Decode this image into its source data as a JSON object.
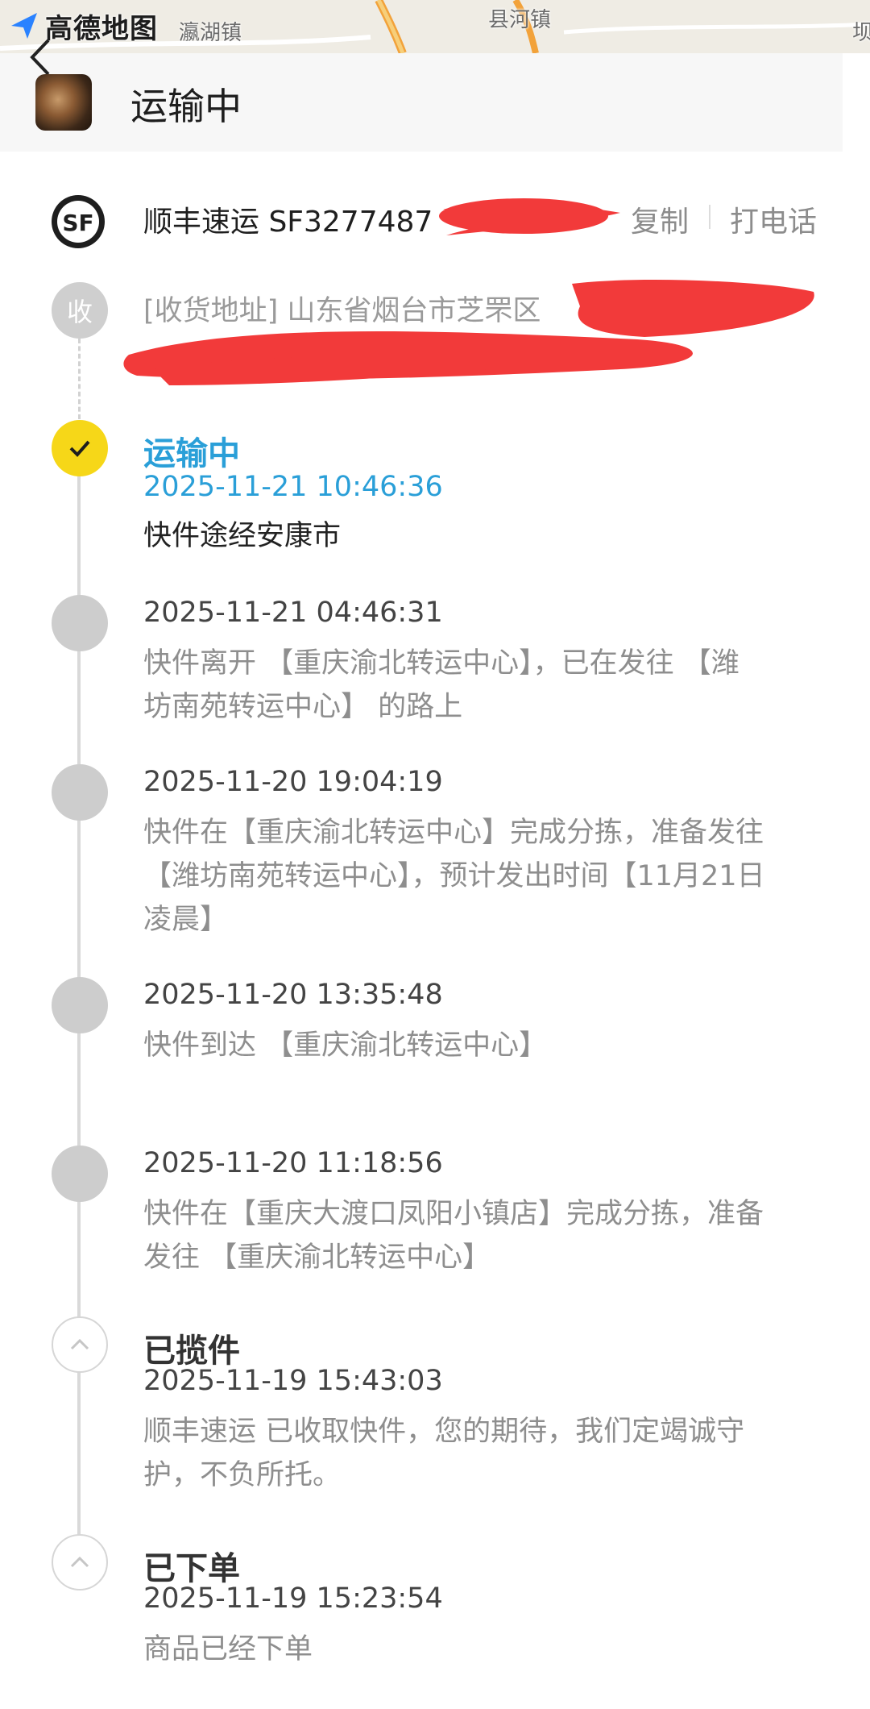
{
  "map": {
    "logo_text": "高德地图",
    "places": [
      "瀛湖镇",
      "县河镇",
      "坝"
    ]
  },
  "header": {
    "title": "运输中"
  },
  "courier": {
    "number_text": "顺丰速运 SF3277487",
    "copy_label": "复制",
    "call_label": "打电话"
  },
  "address": {
    "badge": "收",
    "line1": "[收货地址] 山东省烟台市芝罘区"
  },
  "timeline": [
    {
      "title": "运输中",
      "time": "2025-11-21 10:46:36",
      "desc": "快件途经安康市",
      "state": "active"
    },
    {
      "title": "",
      "time": "2025-11-21 04:46:31",
      "desc_lines": [
        "快件离开 【重庆渝北转运中心】，已在发往 【潍",
        "坊南苑转运中心】 的路上"
      ],
      "state": "grey"
    },
    {
      "title": "",
      "time": "2025-11-20 19:04:19",
      "desc_lines": [
        "快件在【重庆渝北转运中心】完成分拣，准备发往",
        "【潍坊南苑转运中心】，预计发出时间【11月21日",
        "凌晨】"
      ],
      "state": "grey"
    },
    {
      "title": "",
      "time": "2025-11-20 13:35:48",
      "desc_lines": [
        "快件到达 【重庆渝北转运中心】"
      ],
      "state": "grey"
    },
    {
      "title": "",
      "time": "2025-11-20 11:18:56",
      "desc_lines": [
        "快件在【重庆大渡口凤阳小镇店】完成分拣，准备",
        "发往 【重庆渝北转运中心】"
      ],
      "state": "grey"
    },
    {
      "title": "已揽件",
      "time": "2025-11-19 15:43:03",
      "desc_lines": [
        "顺丰速运 已收取快件，您的期待，我们定竭诚守",
        "护，不负所托。"
      ],
      "state": "hollow"
    },
    {
      "title": "已下单",
      "time": "2025-11-19 15:23:54",
      "desc_lines": [
        "商品已经下单"
      ],
      "state": "hollow"
    }
  ],
  "colors": {
    "active_blue": "#2a9fd8",
    "active_node": "#f6d718",
    "redaction": "#f23a3a"
  }
}
